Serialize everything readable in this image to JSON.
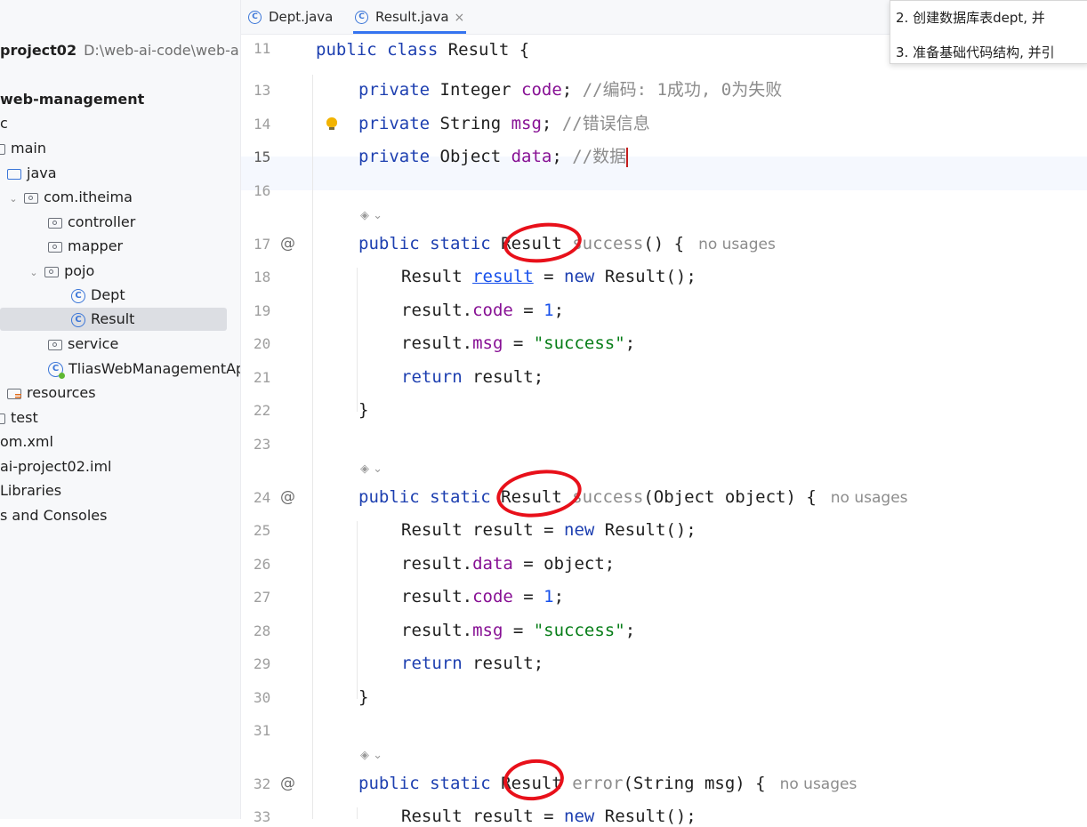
{
  "sidebar": {
    "project_name": "project02",
    "project_path": "D:\\web-ai-code\\web-ai-",
    "items": [
      {
        "label": "web-management"
      },
      {
        "label": "c"
      },
      {
        "label": "main"
      },
      {
        "label": "java"
      },
      {
        "label": "com.itheima"
      },
      {
        "label": "controller"
      },
      {
        "label": "mapper"
      },
      {
        "label": "pojo"
      },
      {
        "label": "Dept"
      },
      {
        "label": "Result"
      },
      {
        "label": "service"
      },
      {
        "label": "TliasWebManagementAp"
      },
      {
        "label": "resources"
      },
      {
        "label": "test"
      },
      {
        "label": "om.xml"
      },
      {
        "label": "ai-project02.iml"
      },
      {
        "label": "Libraries"
      },
      {
        "label": "s and Consoles"
      }
    ]
  },
  "tabs": [
    {
      "label": "Dept.java"
    },
    {
      "label": "Result.java",
      "close": "×"
    }
  ],
  "tooltip": {
    "line1": "2. 创建数据库表dept, 并",
    "line2": "3. 准备基础代码结构, 并引"
  },
  "editor": {
    "line_numbers": [
      "11",
      "13",
      "14",
      "15",
      "16",
      "17",
      "18",
      "19",
      "20",
      "21",
      "22",
      "23",
      "24",
      "25",
      "26",
      "27",
      "28",
      "29",
      "30",
      "31",
      "32",
      "33"
    ],
    "usage_hint": "no usages",
    "colors": {
      "keyword": "#1d3fb0",
      "field": "#871094",
      "number": "#1750eb",
      "string": "#067d17",
      "comment": "#8c8c8c",
      "annotation": "#e8101a"
    },
    "code": {
      "l11": {
        "kw": "public class",
        "rest": " Result {"
      },
      "l13": {
        "kw": "private",
        "type": " Integer ",
        "field": "code",
        "semi": "; ",
        "comment": "//编码: 1成功, 0为失败"
      },
      "l14": {
        "kw": "private",
        "type": " String ",
        "field": "msg",
        "semi": "; ",
        "comment": "//错误信息"
      },
      "l15": {
        "kw": "private",
        "type": " Object ",
        "field": "data",
        "semi": "; ",
        "comment": "//数据"
      },
      "l17": {
        "kw": "public static",
        "type": " Result ",
        "dim": "success",
        "rest": "() {"
      },
      "l18": {
        "a": "Result ",
        "u": "result",
        "b": " = ",
        "kw": "new",
        "c": " Result();"
      },
      "l19": {
        "a": "result.",
        "field": "code",
        "b": " = ",
        "num": "1",
        "c": ";"
      },
      "l20": {
        "a": "result.",
        "field": "msg",
        "b": " = ",
        "str": "\"success\"",
        "c": ";"
      },
      "l21": {
        "kw": "return",
        "c": " result;"
      },
      "l22": {
        "c": "}"
      },
      "l24": {
        "kw": "public static",
        "type": " Result ",
        "dim": "success",
        "rest": "(Object object) {"
      },
      "l25": {
        "a": "Result result = ",
        "kw": "new",
        "c": " Result();"
      },
      "l26": {
        "a": "result.",
        "field": "data",
        "c": " = object;"
      },
      "l27": {
        "a": "result.",
        "field": "code",
        "b": " = ",
        "num": "1",
        "c": ";"
      },
      "l28": {
        "a": "result.",
        "field": "msg",
        "b": " = ",
        "str": "\"success\"",
        "c": ";"
      },
      "l29": {
        "kw": "return",
        "c": " result;"
      },
      "l30": {
        "c": "}"
      },
      "l32": {
        "kw": "public static",
        "type": " Result ",
        "dim": "error",
        "rest": "(String msg) {"
      },
      "l33": {
        "a": "Result result = ",
        "kw": "new",
        "c": " Result();"
      }
    }
  }
}
